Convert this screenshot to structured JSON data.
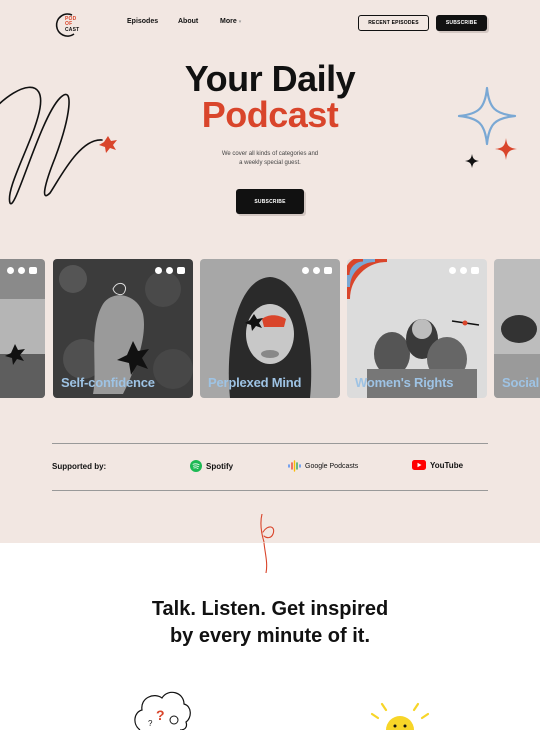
{
  "nav": {
    "logo_lines": [
      "POD",
      "OF",
      "CAST"
    ],
    "links": [
      "Episodes",
      "About",
      "More"
    ],
    "more_arrow": "▾",
    "recent_episodes": "RECENT EPISODES",
    "subscribe": "SUBSCRIBE"
  },
  "hero": {
    "title_line1": "Your Daily",
    "title_line2": "Podcast",
    "subtitle_line1": "We cover all kinds of categories and",
    "subtitle_line2": "a weekly special guest.",
    "subscribe": "SUBSCRIBE"
  },
  "cards": [
    {
      "label": "ot"
    },
    {
      "label": "Self-confidence"
    },
    {
      "label": "Perplexed Mind"
    },
    {
      "label": "Women's Rights"
    },
    {
      "label": "Social"
    }
  ],
  "supported": {
    "label": "Supported by:",
    "brands": [
      "Spotify",
      "Google Podcasts",
      "YouTube"
    ]
  },
  "section2": {
    "line1": "Talk. Listen. Get inspired",
    "line2": "by every minute of it."
  },
  "colors": {
    "background": "#f2e7e2",
    "accent_red": "#d9452b",
    "accent_blue": "#7aa8d4",
    "dark": "#111111"
  }
}
